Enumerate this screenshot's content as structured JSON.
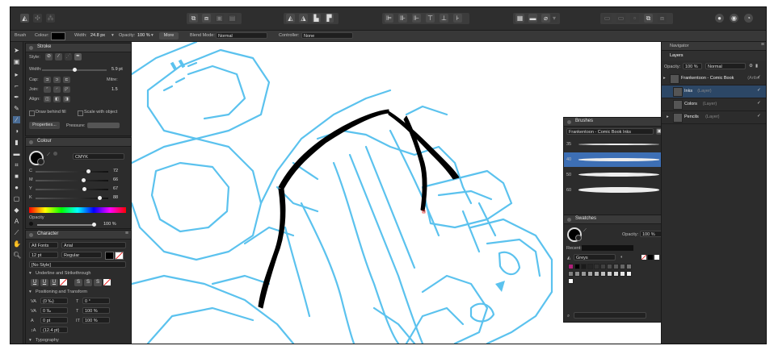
{
  "toolbar": {
    "personas": [
      "persona-draw",
      "persona-pixel",
      "persona-export"
    ]
  },
  "context": {
    "tool": "Brush",
    "colour_label": "Colour:",
    "width_label": "Width:",
    "width_value": "24.8 px",
    "opacity_label": "Opacity:",
    "opacity_value": "100 %",
    "more": "More",
    "blend_label": "Blend Mode:",
    "blend_value": "Normal",
    "controller_label": "Controller:",
    "controller_value": "None"
  },
  "stroke": {
    "title": "Stroke",
    "style_label": "Style:",
    "width_label": "Width:",
    "width_value": "5.9 pt",
    "cap_label": "Cap:",
    "join_label": "Join:",
    "align_label": "Align:",
    "mitre_label": "Mitre:",
    "mitre_value": "1.5",
    "draw_behind": "Draw behind fill",
    "scale_with": "Scale with object",
    "properties": "Properties...",
    "pressure": "Pressure:"
  },
  "colour": {
    "title": "Colour",
    "model": "CMYK",
    "channels": [
      {
        "name": "C",
        "value": "72",
        "pos": 0.72
      },
      {
        "name": "M",
        "value": "66",
        "pos": 0.66
      },
      {
        "name": "Y",
        "value": "67",
        "pos": 0.67
      },
      {
        "name": "K",
        "value": "88",
        "pos": 0.88
      }
    ],
    "opacity_label": "Opacity",
    "opacity_value": "100 %"
  },
  "character": {
    "title": "Character",
    "font_collection": "All Fonts",
    "font": "Arial",
    "size": "12 pt",
    "weight": "Regular",
    "style": "[No Style]",
    "underline_section": "Underline and Strikethrough",
    "position_section": "Positioning and Transform",
    "kerning": "(0 ‰)",
    "tracking": "0 ‰",
    "baseline": "0 pt",
    "leading": "(12.4 pt)",
    "shear": "0 °",
    "hscale": "100 %",
    "vscale": "100 %",
    "typography_section": "Typography"
  },
  "brushes": {
    "title": "Brushes",
    "category": "Frankentoon - Comic Book Inks",
    "sizes": [
      "35",
      "40",
      "50",
      "60"
    ],
    "selected_index": 1
  },
  "swatches": {
    "title": "Swatches",
    "opacity_label": "Opacity:",
    "opacity_value": "100 %",
    "recent_label": "Recent:",
    "palette": "Greys",
    "greys": [
      "#000000",
      "#1a1a1a",
      "#262626",
      "#333333",
      "#404040",
      "#4d4d4d",
      "#595959",
      "#666666",
      "#737373",
      "#808080",
      "#8c8c8c",
      "#999999",
      "#a6a6a6",
      "#b3b3b3",
      "#bfbfbf",
      "#cccccc",
      "#d9d9d9",
      "#e6e6e6",
      "#f2f2f2",
      "#ffffff"
    ],
    "highlight_colour": "#b0207a"
  },
  "navigator": {
    "tab": "Navigator"
  },
  "layers": {
    "tab": "Layers",
    "opacity_label": "Opacity:",
    "opacity_value": "100 %",
    "blend_value": "Normal",
    "items": [
      {
        "name": "Frankentoon - Comic Book",
        "type": "(Artbo",
        "selected": false,
        "indent": 0
      },
      {
        "name": "Inks",
        "type": "(Layer)",
        "selected": true,
        "indent": 1
      },
      {
        "name": "Colors",
        "type": "(Layer)",
        "selected": false,
        "indent": 1
      },
      {
        "name": "Pencils",
        "type": "(Layer)",
        "selected": false,
        "indent": 1
      }
    ]
  },
  "colors": {
    "accent": "#2c4766",
    "sketch_blue": "#5bc2ee",
    "ink": "#000000"
  }
}
